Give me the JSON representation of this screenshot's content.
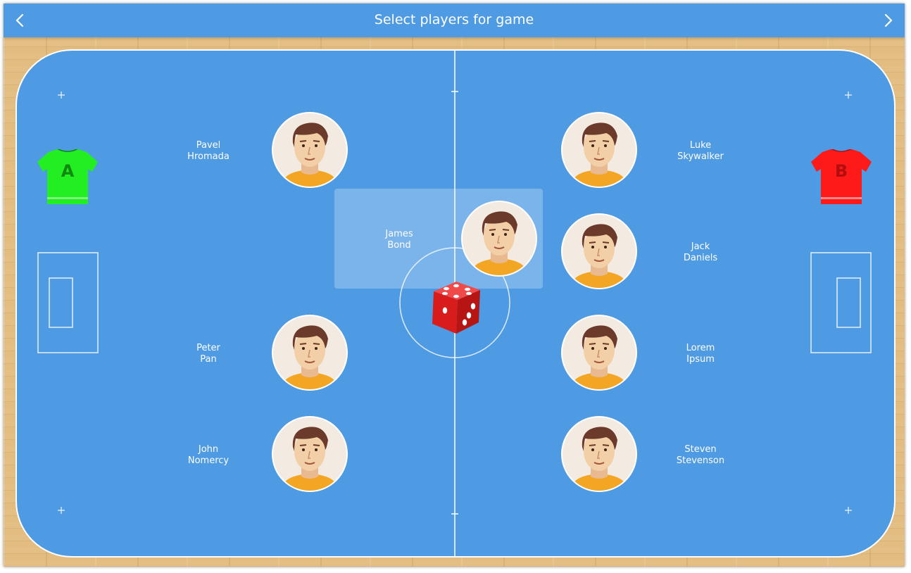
{
  "header": {
    "title": "Select players for game",
    "back_icon": "chevron-left-icon",
    "next_icon": "chevron-right-icon",
    "color": "#4f9be3"
  },
  "court": {
    "color": "#4f9be3",
    "line_color": "#ffffff",
    "floor_color": "#e2bc80"
  },
  "teams": {
    "a": {
      "letter": "A",
      "jersey_color": "#22ee22",
      "letter_color": "#0f8a0f"
    },
    "b": {
      "letter": "B",
      "jersey_color": "#ff1a1a",
      "letter_color": "#b30d0d"
    }
  },
  "players": {
    "left": [
      {
        "first": "Pavel",
        "last": "Hromada"
      },
      {
        "first": "Peter",
        "last": "Pan"
      },
      {
        "first": "John",
        "last": "Nomercy"
      }
    ],
    "right": [
      {
        "first": "Luke",
        "last": "Skywalker"
      },
      {
        "first": "Jack",
        "last": "Daniels"
      },
      {
        "first": "Lorem",
        "last": "Ipsum"
      },
      {
        "first": "Steven",
        "last": "Stevenson"
      }
    ],
    "center": {
      "first": "James",
      "last": "Bond"
    }
  },
  "dice": {
    "icon": "dice-icon",
    "color": "#e01b1b"
  }
}
